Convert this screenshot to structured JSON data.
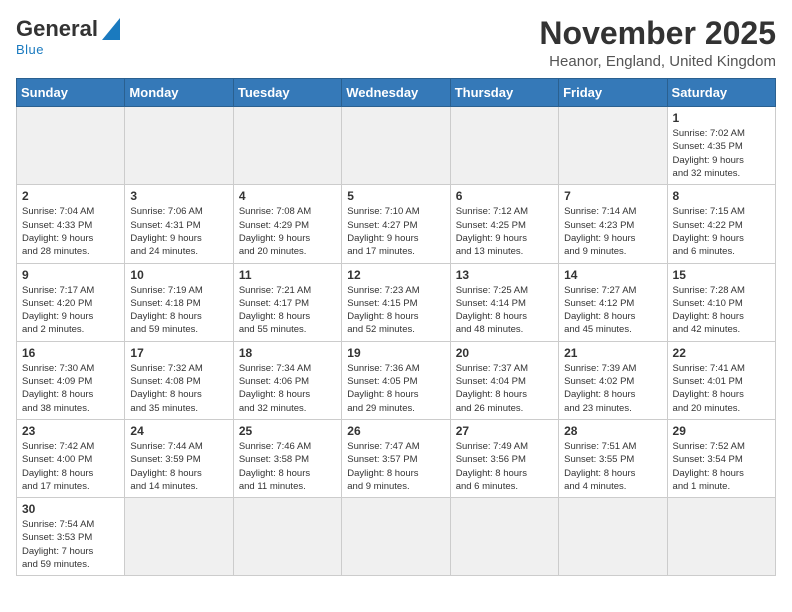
{
  "logo": {
    "general": "General",
    "blue": "Blue"
  },
  "title": "November 2025",
  "subtitle": "Heanor, England, United Kingdom",
  "weekdays": [
    "Sunday",
    "Monday",
    "Tuesday",
    "Wednesday",
    "Thursday",
    "Friday",
    "Saturday"
  ],
  "weeks": [
    [
      {
        "day": "",
        "info": ""
      },
      {
        "day": "",
        "info": ""
      },
      {
        "day": "",
        "info": ""
      },
      {
        "day": "",
        "info": ""
      },
      {
        "day": "",
        "info": ""
      },
      {
        "day": "",
        "info": ""
      },
      {
        "day": "1",
        "info": "Sunrise: 7:02 AM\nSunset: 4:35 PM\nDaylight: 9 hours\nand 32 minutes."
      }
    ],
    [
      {
        "day": "2",
        "info": "Sunrise: 7:04 AM\nSunset: 4:33 PM\nDaylight: 9 hours\nand 28 minutes."
      },
      {
        "day": "3",
        "info": "Sunrise: 7:06 AM\nSunset: 4:31 PM\nDaylight: 9 hours\nand 24 minutes."
      },
      {
        "day": "4",
        "info": "Sunrise: 7:08 AM\nSunset: 4:29 PM\nDaylight: 9 hours\nand 20 minutes."
      },
      {
        "day": "5",
        "info": "Sunrise: 7:10 AM\nSunset: 4:27 PM\nDaylight: 9 hours\nand 17 minutes."
      },
      {
        "day": "6",
        "info": "Sunrise: 7:12 AM\nSunset: 4:25 PM\nDaylight: 9 hours\nand 13 minutes."
      },
      {
        "day": "7",
        "info": "Sunrise: 7:14 AM\nSunset: 4:23 PM\nDaylight: 9 hours\nand 9 minutes."
      },
      {
        "day": "8",
        "info": "Sunrise: 7:15 AM\nSunset: 4:22 PM\nDaylight: 9 hours\nand 6 minutes."
      }
    ],
    [
      {
        "day": "9",
        "info": "Sunrise: 7:17 AM\nSunset: 4:20 PM\nDaylight: 9 hours\nand 2 minutes."
      },
      {
        "day": "10",
        "info": "Sunrise: 7:19 AM\nSunset: 4:18 PM\nDaylight: 8 hours\nand 59 minutes."
      },
      {
        "day": "11",
        "info": "Sunrise: 7:21 AM\nSunset: 4:17 PM\nDaylight: 8 hours\nand 55 minutes."
      },
      {
        "day": "12",
        "info": "Sunrise: 7:23 AM\nSunset: 4:15 PM\nDaylight: 8 hours\nand 52 minutes."
      },
      {
        "day": "13",
        "info": "Sunrise: 7:25 AM\nSunset: 4:14 PM\nDaylight: 8 hours\nand 48 minutes."
      },
      {
        "day": "14",
        "info": "Sunrise: 7:27 AM\nSunset: 4:12 PM\nDaylight: 8 hours\nand 45 minutes."
      },
      {
        "day": "15",
        "info": "Sunrise: 7:28 AM\nSunset: 4:10 PM\nDaylight: 8 hours\nand 42 minutes."
      }
    ],
    [
      {
        "day": "16",
        "info": "Sunrise: 7:30 AM\nSunset: 4:09 PM\nDaylight: 8 hours\nand 38 minutes."
      },
      {
        "day": "17",
        "info": "Sunrise: 7:32 AM\nSunset: 4:08 PM\nDaylight: 8 hours\nand 35 minutes."
      },
      {
        "day": "18",
        "info": "Sunrise: 7:34 AM\nSunset: 4:06 PM\nDaylight: 8 hours\nand 32 minutes."
      },
      {
        "day": "19",
        "info": "Sunrise: 7:36 AM\nSunset: 4:05 PM\nDaylight: 8 hours\nand 29 minutes."
      },
      {
        "day": "20",
        "info": "Sunrise: 7:37 AM\nSunset: 4:04 PM\nDaylight: 8 hours\nand 26 minutes."
      },
      {
        "day": "21",
        "info": "Sunrise: 7:39 AM\nSunset: 4:02 PM\nDaylight: 8 hours\nand 23 minutes."
      },
      {
        "day": "22",
        "info": "Sunrise: 7:41 AM\nSunset: 4:01 PM\nDaylight: 8 hours\nand 20 minutes."
      }
    ],
    [
      {
        "day": "23",
        "info": "Sunrise: 7:42 AM\nSunset: 4:00 PM\nDaylight: 8 hours\nand 17 minutes."
      },
      {
        "day": "24",
        "info": "Sunrise: 7:44 AM\nSunset: 3:59 PM\nDaylight: 8 hours\nand 14 minutes."
      },
      {
        "day": "25",
        "info": "Sunrise: 7:46 AM\nSunset: 3:58 PM\nDaylight: 8 hours\nand 11 minutes."
      },
      {
        "day": "26",
        "info": "Sunrise: 7:47 AM\nSunset: 3:57 PM\nDaylight: 8 hours\nand 9 minutes."
      },
      {
        "day": "27",
        "info": "Sunrise: 7:49 AM\nSunset: 3:56 PM\nDaylight: 8 hours\nand 6 minutes."
      },
      {
        "day": "28",
        "info": "Sunrise: 7:51 AM\nSunset: 3:55 PM\nDaylight: 8 hours\nand 4 minutes."
      },
      {
        "day": "29",
        "info": "Sunrise: 7:52 AM\nSunset: 3:54 PM\nDaylight: 8 hours\nand 1 minute."
      }
    ],
    [
      {
        "day": "30",
        "info": "Sunrise: 7:54 AM\nSunset: 3:53 PM\nDaylight: 7 hours\nand 59 minutes."
      },
      {
        "day": "",
        "info": ""
      },
      {
        "day": "",
        "info": ""
      },
      {
        "day": "",
        "info": ""
      },
      {
        "day": "",
        "info": ""
      },
      {
        "day": "",
        "info": ""
      },
      {
        "day": "",
        "info": ""
      }
    ]
  ]
}
